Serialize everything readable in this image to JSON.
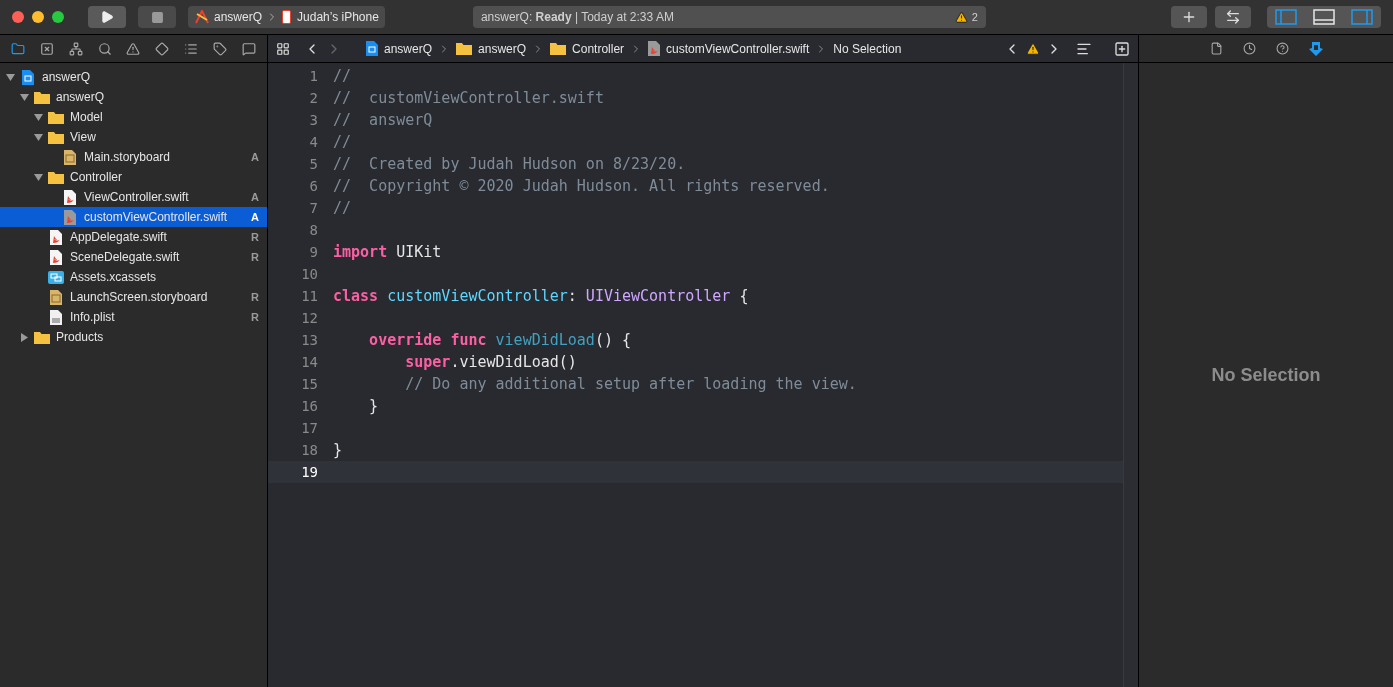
{
  "toolbar": {
    "scheme": {
      "project": "answerQ",
      "device": "Judah’s iPhone"
    },
    "status": {
      "text": "answerQ: **Ready** | Today at 2:33 AM",
      "warnings": "2"
    },
    "view_toggles": [
      {
        "kind": "navigator",
        "selected": true
      },
      {
        "kind": "debug",
        "selected": false
      },
      {
        "kind": "inspector",
        "selected": true
      }
    ]
  },
  "navigator_tabs": [
    {
      "kind": "folder",
      "selected": true
    },
    {
      "kind": "source-control",
      "selected": false
    },
    {
      "kind": "hierarchy",
      "selected": false
    },
    {
      "kind": "search",
      "selected": false
    },
    {
      "kind": "warning",
      "selected": false
    },
    {
      "kind": "test",
      "selected": false
    },
    {
      "kind": "debug",
      "selected": false
    },
    {
      "kind": "breakpoint",
      "selected": false
    },
    {
      "kind": "report",
      "selected": false
    }
  ],
  "tree": [
    {
      "name": "answerQ",
      "kind": "project",
      "expanded": true,
      "selected": false,
      "children": [
        {
          "name": "answerQ",
          "kind": "folder",
          "expanded": true,
          "selected": false,
          "children": [
            {
              "name": "Model",
              "kind": "folder",
              "expanded": true,
              "selected": false
            },
            {
              "name": "View",
              "kind": "folder",
              "expanded": true,
              "selected": false,
              "children": [
                {
                  "name": "Main.storyboard",
                  "kind": "storyboard",
                  "badge": "A",
                  "selected": false
                }
              ]
            },
            {
              "name": "Controller",
              "kind": "folder",
              "expanded": true,
              "selected": false,
              "children": [
                {
                  "name": "ViewController.swift",
                  "kind": "swift",
                  "badge": "A",
                  "selected": false
                },
                {
                  "name": "customViewController.swift",
                  "kind": "swift-gray",
                  "badge": "A",
                  "selected": true
                }
              ]
            },
            {
              "name": "AppDelegate.swift",
              "kind": "swift",
              "badge": "R",
              "selected": false
            },
            {
              "name": "SceneDelegate.swift",
              "kind": "swift",
              "badge": "R",
              "selected": false
            },
            {
              "name": "Assets.xcassets",
              "kind": "assets",
              "selected": false
            },
            {
              "name": "LaunchScreen.storyboard",
              "kind": "storyboard",
              "badge": "R",
              "selected": false
            },
            {
              "name": "Info.plist",
              "kind": "plist",
              "badge": "R",
              "selected": false
            }
          ]
        },
        {
          "name": "Products",
          "kind": "folder",
          "expanded": false,
          "selected": false
        }
      ]
    }
  ],
  "jump_bar": [
    {
      "name": "answerQ",
      "kind": "project"
    },
    {
      "name": "answerQ",
      "kind": "folder"
    },
    {
      "name": "Controller",
      "kind": "folder"
    },
    {
      "name": "customViewController.swift",
      "kind": "swift-gray"
    },
    {
      "name": "No Selection",
      "kind": "none"
    }
  ],
  "editor": {
    "lines": [
      {
        "number": "1",
        "current": false,
        "tokens": [
          {
            "kind": "comment",
            "text": "//"
          }
        ]
      },
      {
        "number": "2",
        "current": false,
        "tokens": [
          {
            "kind": "comment",
            "text": "//  customViewController.swift"
          }
        ]
      },
      {
        "number": "3",
        "current": false,
        "tokens": [
          {
            "kind": "comment",
            "text": "//  answerQ"
          }
        ]
      },
      {
        "number": "4",
        "current": false,
        "tokens": [
          {
            "kind": "comment",
            "text": "//"
          }
        ]
      },
      {
        "number": "5",
        "current": false,
        "tokens": [
          {
            "kind": "comment",
            "text": "//  Created by Judah Hudson on 8/23/20."
          }
        ]
      },
      {
        "number": "6",
        "current": false,
        "tokens": [
          {
            "kind": "comment",
            "text": "//  Copyright © 2020 Judah Hudson. All rights reserved."
          }
        ]
      },
      {
        "number": "7",
        "current": false,
        "tokens": [
          {
            "kind": "comment",
            "text": "//"
          }
        ]
      },
      {
        "number": "8",
        "current": false
      },
      {
        "number": "9",
        "current": false,
        "tokens": [
          {
            "kind": "keyword",
            "text": "import"
          },
          {
            "kind": "plain",
            "text": " UIKit"
          }
        ]
      },
      {
        "number": "10",
        "current": false
      },
      {
        "number": "11",
        "current": false,
        "tokens": [
          {
            "kind": "keyword",
            "text": "class"
          },
          {
            "kind": "declaration",
            "text": " customViewController"
          },
          {
            "kind": "plain",
            "text": ":"
          },
          {
            "kind": "type",
            "text": " UIViewController"
          },
          {
            "kind": "plain",
            "text": " {"
          }
        ]
      },
      {
        "number": "12",
        "current": false
      },
      {
        "number": "13",
        "current": false,
        "tokens": [
          {
            "kind": "keyword",
            "text": "    override"
          },
          {
            "kind": "keyword",
            "text": " func"
          },
          {
            "kind": "function",
            "text": " viewDidLoad"
          },
          {
            "kind": "plain",
            "text": "() {"
          }
        ]
      },
      {
        "number": "14",
        "current": false,
        "tokens": [
          {
            "kind": "keyword",
            "text": "        super"
          },
          {
            "kind": "plain",
            "text": ".viewDidLoad()"
          }
        ]
      },
      {
        "number": "15",
        "current": false,
        "tokens": [
          {
            "kind": "comment",
            "text": "        // Do any additional setup after loading the view."
          }
        ]
      },
      {
        "number": "16",
        "current": false,
        "tokens": [
          {
            "kind": "plain",
            "text": "    }"
          }
        ]
      },
      {
        "number": "17",
        "current": false
      },
      {
        "number": "18",
        "current": false,
        "tokens": [
          {
            "kind": "plain",
            "text": "}"
          }
        ]
      },
      {
        "number": "19",
        "current": true
      }
    ]
  },
  "inspector": {
    "tabs": [
      {
        "kind": "file",
        "selected": false
      },
      {
        "kind": "history",
        "selected": false
      },
      {
        "kind": "help",
        "selected": false
      },
      {
        "kind": "attributes",
        "selected": true
      }
    ],
    "empty_text": "No Selection"
  }
}
